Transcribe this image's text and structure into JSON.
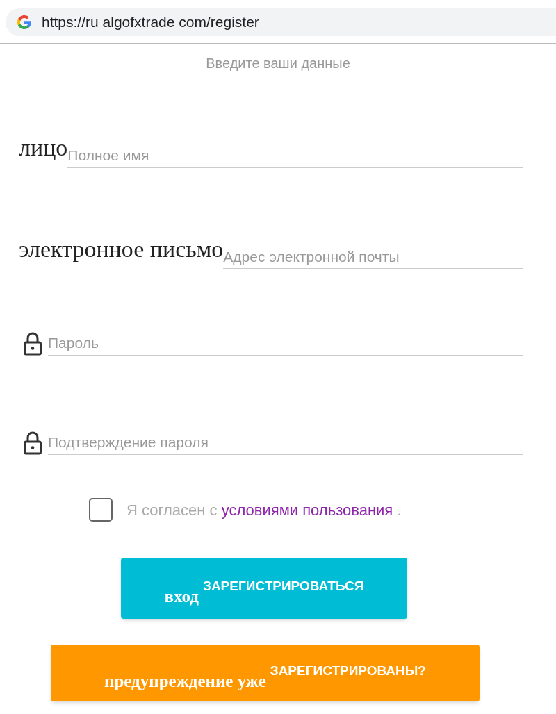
{
  "address_bar": {
    "url": "https://ru algofxtrade com/register"
  },
  "subtitle": "Введите ваши данные",
  "fields": [
    {
      "kind": "label",
      "label": "лицо",
      "placeholder": "Полное имя"
    },
    {
      "kind": "label",
      "label": "электронное письмо",
      "placeholder": "Адрес электронной почты"
    },
    {
      "kind": "lock",
      "placeholder": "Пароль"
    },
    {
      "kind": "lock",
      "placeholder": "Подтверждение пароля"
    }
  ],
  "terms": {
    "checked": false,
    "text": "Я согласен с",
    "link": "условиями пользования",
    "end": "."
  },
  "buttons": [
    {
      "kind": "primary",
      "prefix": "вход",
      "label": "ЗАРЕГИСТРИРОВАТЬСЯ"
    },
    {
      "kind": "warning",
      "prefix": "предупреждение уже",
      "label": "ЗАРЕГИСТРИРОВАНЫ?"
    }
  ]
}
